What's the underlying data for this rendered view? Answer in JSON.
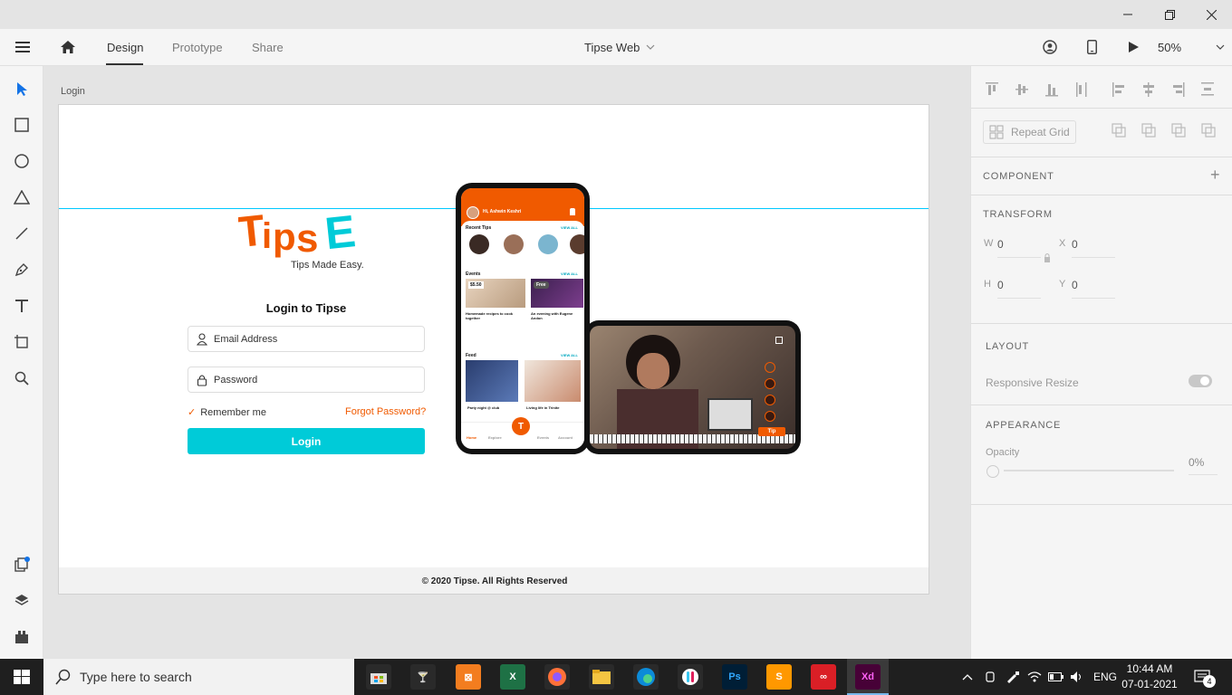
{
  "toolbar": {
    "tabs": [
      "Design",
      "Prototype",
      "Share"
    ],
    "doc_title": "Tipse Web",
    "zoom": "50%"
  },
  "canvas": {
    "artboard_label": "Login"
  },
  "login": {
    "brand": "TipsE",
    "tagline": "Tips Made Easy.",
    "title": "Login to Tipse",
    "email_placeholder": "Email Address",
    "password_placeholder": "Password",
    "remember": "Remember me",
    "forgot": "Forgot Password?",
    "login_button": "Login",
    "footer": "© 2020 Tipse. All Rights Reserved"
  },
  "phone": {
    "greeting": "Hi, Ashwin Keshri",
    "recent_tips": "Recent Tips",
    "view_all": "VIEW ALL",
    "events": "Events",
    "feed": "Feed",
    "event1_price": "$5.50",
    "event2_badge": "Free",
    "event1_title": "Homemade recipes to cook together",
    "event2_title": "An evening with Eugene Andon",
    "feed1_title": "Party night @ club",
    "feed2_title": "Living life in Trinite",
    "tip_button": "Tip",
    "nav": [
      "Home",
      "Explore",
      "Events",
      "Account"
    ]
  },
  "rightpanel": {
    "repeat_grid": "Repeat Grid",
    "component": "COMPONENT",
    "transform": "TRANSFORM",
    "w_label": "W",
    "w_value": "0",
    "x_label": "X",
    "x_value": "0",
    "h_label": "H",
    "h_value": "0",
    "y_label": "Y",
    "y_value": "0",
    "layout": "LAYOUT",
    "responsive_resize": "Responsive Resize",
    "appearance": "APPEARANCE",
    "opacity_label": "Opacity",
    "opacity_value": "0%"
  },
  "taskbar": {
    "search_placeholder": "Type here to search",
    "language": "ENG",
    "time": "10:44 AM",
    "date": "07-01-2021",
    "notifications": "4"
  },
  "colors": {
    "accent_orange": "#f05a00",
    "accent_cyan": "#00cbd8",
    "guide": "#00c8ff"
  }
}
